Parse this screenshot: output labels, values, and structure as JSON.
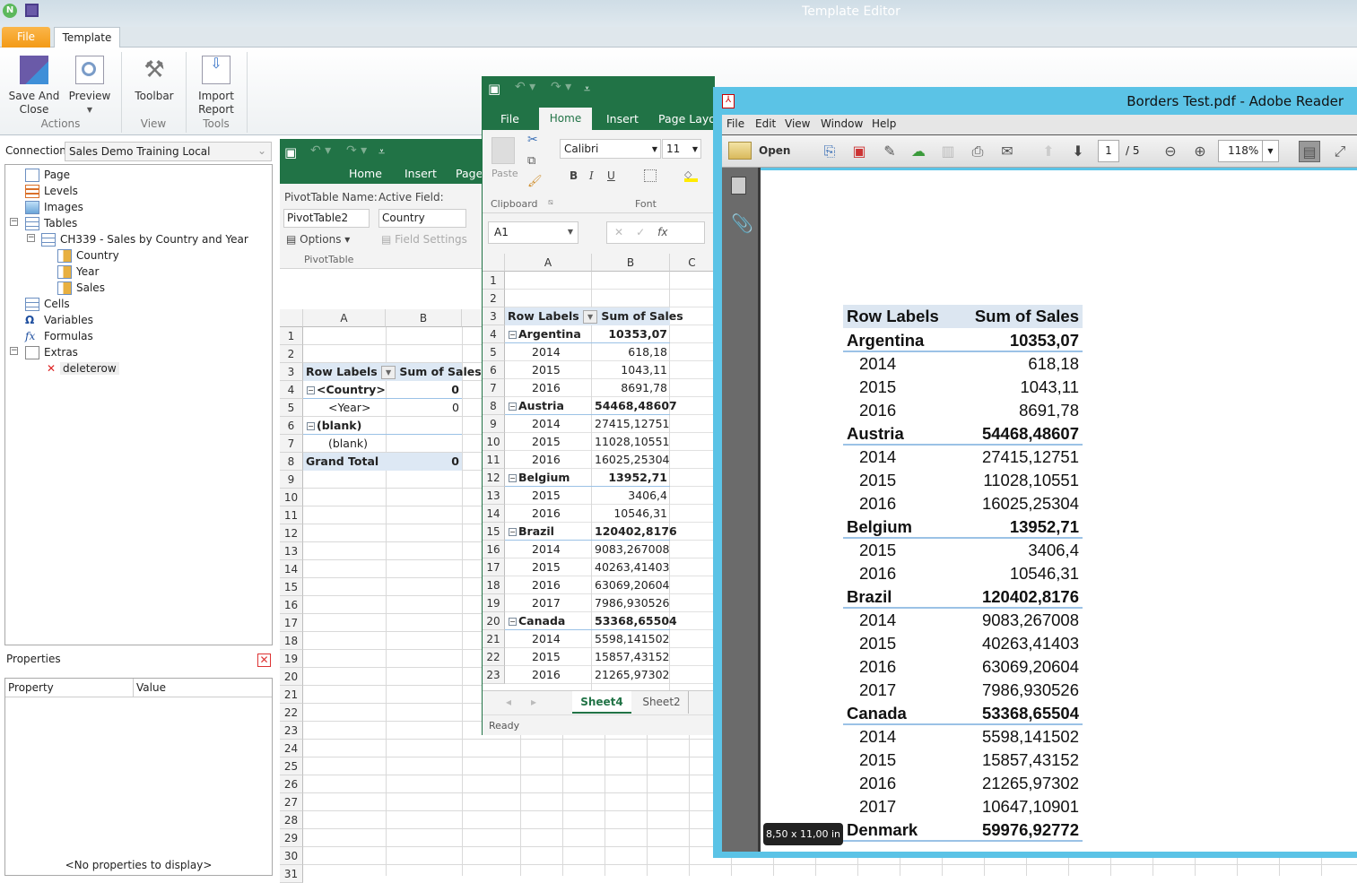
{
  "app": {
    "title": "Template Editor"
  },
  "ribbon": {
    "tabs": {
      "file": "File",
      "template": "Template"
    },
    "buttons": {
      "save_and_close": "Save And Close",
      "preview": "Preview",
      "toolbar": "Toolbar",
      "import_report": "Import Report"
    },
    "groups": {
      "actions": "Actions",
      "view": "View",
      "tools": "Tools"
    }
  },
  "connection": {
    "label": "Connection",
    "value": "Sales Demo Training Local"
  },
  "tree": {
    "page": "Page",
    "levels": "Levels",
    "images": "Images",
    "tables": "Tables",
    "table_name": "CH339 - Sales by Country and Year",
    "fields": [
      "Country",
      "Year",
      "Sales"
    ],
    "cells": "Cells",
    "variables": "Variables",
    "formulas": "Formulas",
    "extras": "Extras",
    "deleterow": "deleterow"
  },
  "properties": {
    "title": "Properties",
    "col_property": "Property",
    "col_value": "Value",
    "empty": "<No properties to display>"
  },
  "left_excel": {
    "tabs": {
      "home": "Home",
      "insert": "Insert",
      "page": "Page"
    },
    "pivot_name_label": "PivotTable Name:",
    "pivot_name": "PivotTable2",
    "active_field_label": "Active Field:",
    "active_field": "Country",
    "options": "Options",
    "field_settings": "Field Settings",
    "group_label": "PivotTable",
    "columns": [
      "A",
      "B"
    ],
    "row_numbers": [
      "1",
      "2",
      "3",
      "4",
      "5",
      "6",
      "7",
      "8",
      "9",
      "10",
      "11",
      "12",
      "13",
      "14",
      "15",
      "16",
      "17",
      "18",
      "19",
      "20",
      "21",
      "22",
      "23",
      "24",
      "25",
      "26",
      "27",
      "28",
      "29",
      "30",
      "31"
    ],
    "pivot": {
      "header_label": "Row Labels",
      "header_value": "Sum of Sales",
      "rows": [
        {
          "label": "<Country>",
          "value": "0",
          "bold": true
        },
        {
          "label": "<Year>",
          "value": "0",
          "bold": false
        },
        {
          "label": "(blank)",
          "value": "",
          "bold": true
        },
        {
          "label": "(blank)",
          "value": "",
          "bold": false
        }
      ],
      "grand_total_label": "Grand Total",
      "grand_total": "0"
    }
  },
  "excel": {
    "tabs": {
      "file": "File",
      "home": "Home",
      "insert": "Insert",
      "page_layout": "Page Layou"
    },
    "clipboard": {
      "paste": "Paste",
      "group": "Clipboard"
    },
    "font": {
      "name": "Calibri",
      "size": "11",
      "group": "Font",
      "bold": "B",
      "italic": "I",
      "underline": "U"
    },
    "name_box": "A1",
    "columns": [
      "A",
      "B",
      "C"
    ],
    "row_numbers": [
      "1",
      "2",
      "3",
      "4",
      "5",
      "6",
      "7",
      "8",
      "9",
      "10",
      "11",
      "12",
      "13",
      "14",
      "15",
      "16",
      "17",
      "18",
      "19",
      "20",
      "21",
      "22",
      "23"
    ],
    "sheets": [
      "Sheet4",
      "Sheet2"
    ],
    "active_sheet": "Sheet4",
    "status": "Ready",
    "accent": "#217346"
  },
  "pivot": {
    "header_label": "Row Labels",
    "header_value": "Sum of Sales",
    "rows": [
      {
        "label": "Argentina",
        "value": "10353,07",
        "country": true
      },
      {
        "label": "2014",
        "value": "618,18"
      },
      {
        "label": "2015",
        "value": "1043,11"
      },
      {
        "label": "2016",
        "value": "8691,78"
      },
      {
        "label": "Austria",
        "value": "54468,48607",
        "country": true
      },
      {
        "label": "2014",
        "value": "27415,12751"
      },
      {
        "label": "2015",
        "value": "11028,10551"
      },
      {
        "label": "2016",
        "value": "16025,25304"
      },
      {
        "label": "Belgium",
        "value": "13952,71",
        "country": true
      },
      {
        "label": "2015",
        "value": "3406,4"
      },
      {
        "label": "2016",
        "value": "10546,31"
      },
      {
        "label": "Brazil",
        "value": "120402,8176",
        "country": true
      },
      {
        "label": "2014",
        "value": "9083,267008"
      },
      {
        "label": "2015",
        "value": "40263,41403"
      },
      {
        "label": "2016",
        "value": "63069,20604"
      },
      {
        "label": "2017",
        "value": "7986,930526"
      },
      {
        "label": "Canada",
        "value": "53368,65504",
        "country": true
      },
      {
        "label": "2014",
        "value": "5598,141502"
      },
      {
        "label": "2015",
        "value": "15857,43152"
      },
      {
        "label": "2016",
        "value": "21265,97302"
      },
      {
        "label": "2017",
        "value": "10647,10901"
      },
      {
        "label": "Denmark",
        "value": "59976,92772",
        "country": true
      }
    ]
  },
  "pdf": {
    "title": "Borders Test.pdf - Adobe Reader",
    "menu": [
      "File",
      "Edit",
      "View",
      "Window",
      "Help"
    ],
    "open": "Open",
    "page": "1",
    "page_total": "/ 5",
    "zoom": "118%",
    "page_size": "8,50 x 11,00 in",
    "accent": "#5bc3e6"
  }
}
